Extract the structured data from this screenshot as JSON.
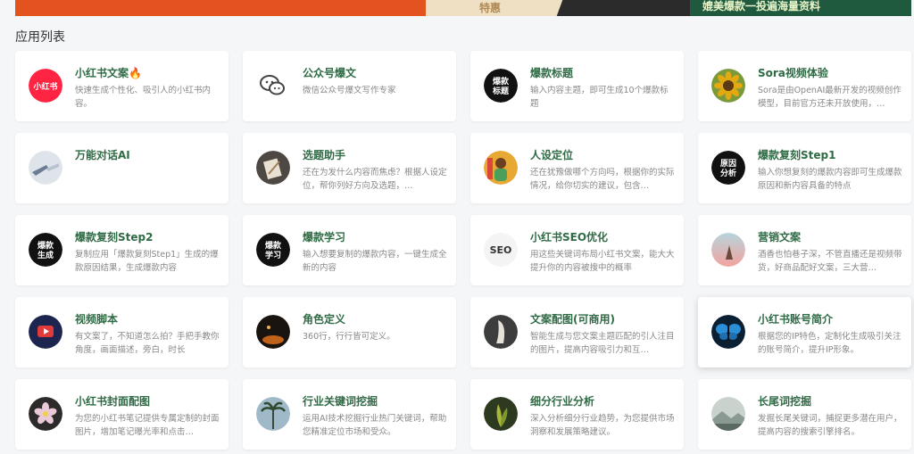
{
  "banner": {
    "mid_text": "特惠",
    "right_text": "媲美爆款一投遍海量资料"
  },
  "section_title": "应用列表",
  "cards": [
    {
      "title": "小红书文案🔥",
      "desc": "快速生成个性化、吸引人的小红书内容。",
      "icon": "xiaohongshu-logo-icon",
      "avatar_text": "小红书",
      "color": "#ff2442"
    },
    {
      "title": "公众号爆文",
      "desc": "微信公众号爆文写作专家",
      "icon": "wechat-icon",
      "color": "#ffffff"
    },
    {
      "title": "爆款标题",
      "desc": "输入内容主题，即可生成10个爆款标题",
      "icon": "hot-title-icon",
      "avatar_text": "爆款标题",
      "color": "#111111"
    },
    {
      "title": "Sora视频体验",
      "desc": "Sora是由OpenAI最新开发的视频创作模型，目前官方还未开放使用，…",
      "icon": "sunflower-icon",
      "color": "#e4a812"
    },
    {
      "title": "万能对话AI",
      "desc": "",
      "icon": "robot-hand-icon",
      "color": "#6b7d94"
    },
    {
      "title": "选题助手",
      "desc": "还在为发什么内容而焦虑？根据人设定位，帮你列好方向及选题，…",
      "icon": "notebook-icon",
      "color": "#4d4844"
    },
    {
      "title": "人设定位",
      "desc": "还在犹豫做哪个方向吗，根据你的实际情况，给你切实的建议，包含…",
      "icon": "portrait-icon",
      "color": "#e8a834"
    },
    {
      "title": "爆款复刻Step1",
      "desc": "输入你想复刻的爆款内容即可生成爆款原因和新内容具备的特点",
      "icon": "analysis-icon",
      "avatar_text": "原因分析",
      "color": "#111111"
    },
    {
      "title": "爆款复刻Step2",
      "desc": "复制应用「爆款复刻Step1」生成的爆款原因结果，生成爆款内容",
      "icon": "generate-icon",
      "avatar_text": "爆款生成",
      "color": "#111111"
    },
    {
      "title": "爆款学习",
      "desc": "输入想要复制的爆款内容，一键生成全新的内容",
      "icon": "study-icon",
      "avatar_text": "爆款学习",
      "color": "#111111"
    },
    {
      "title": "小红书SEO优化",
      "desc": "用这些关键词布局小红书文案，能大大提升你的内容被搜中的概率",
      "icon": "seo-icon",
      "avatar_text": "SEO",
      "color": "#f4f4f4"
    },
    {
      "title": "营销文案",
      "desc": "酒香也怕巷子深，不管直播还是视频带货，好商品配好文案，三大营…",
      "icon": "marketing-icon",
      "color": "#f2a3a0"
    },
    {
      "title": "视频脚本",
      "desc": "有文案了，不知道怎么拍？手把手教你角度，画面描述，旁白，时长",
      "icon": "video-play-icon",
      "color": "#1c2550"
    },
    {
      "title": "角色定义",
      "desc": "360行，行行皆可定义。",
      "icon": "night-scene-icon",
      "color": "#1a1410"
    },
    {
      "title": "文案配图(可商用)",
      "desc": "智能生成与您文案主题匹配的引人注目的图片，提高内容吸引力和互…",
      "icon": "figure-art-icon",
      "color": "#3d3d3d"
    },
    {
      "title": "小红书账号简介",
      "desc": "根据您的IP特色，定制化生成吸引关注的账号简介，提升IP形象。",
      "icon": "butterfly-icon",
      "color": "#0b1f33"
    },
    {
      "title": "小红书封面配图",
      "desc": "为您的小红书笔记提供专属定制的封面图片，增加笔记曝光率和点击…",
      "icon": "flower-icon",
      "color": "#2d2a2a"
    },
    {
      "title": "行业关键词挖掘",
      "desc": "运用AI技术挖掘行业热门关键词，帮助您精准定位市场和受众。",
      "icon": "palm-tree-icon",
      "color": "#9fb9c9"
    },
    {
      "title": "细分行业分析",
      "desc": "深入分析细分行业趋势，为您提供市场洞察和发展策略建议。",
      "icon": "plant-icon",
      "color": "#2e3a1f"
    },
    {
      "title": "长尾词挖掘",
      "desc": "发掘长尾关键词，捕捉更多潜在用户，提高内容的搜索引擎排名。",
      "icon": "landscape-icon",
      "color": "#8a9a92"
    }
  ]
}
